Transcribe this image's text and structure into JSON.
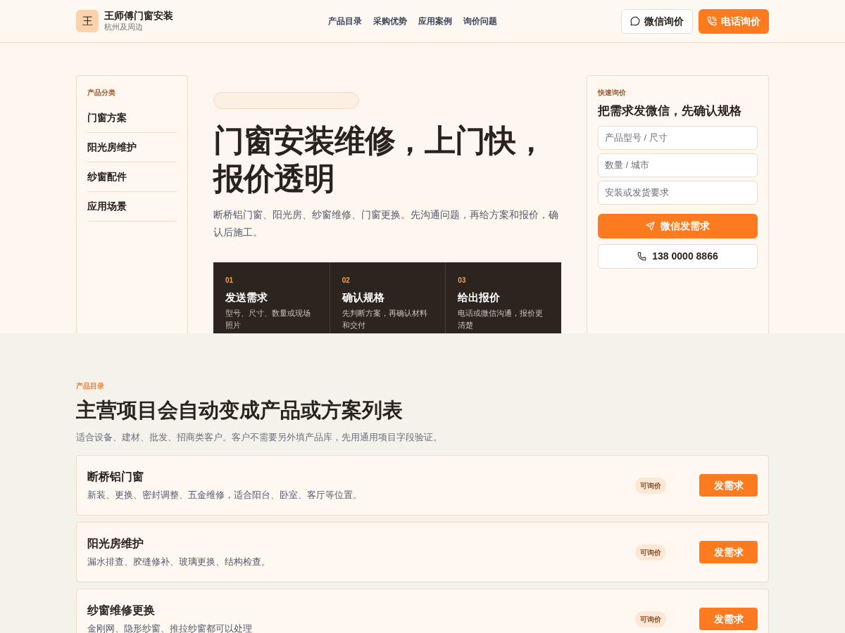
{
  "header": {
    "logo_char": "王",
    "brand": "王师傅门窗安装",
    "region": "杭州及周边",
    "nav": [
      "产品目录",
      "采购优势",
      "应用案例",
      "询价问题"
    ],
    "buttons": [
      {
        "kind": "wechat",
        "label": "微信询价"
      },
      {
        "kind": "phone",
        "label": "电话询价"
      }
    ]
  },
  "sidebar": {
    "heading": "产品分类",
    "items": [
      "门窗方案",
      "阳光房维护",
      "纱窗配件",
      "应用场景"
    ]
  },
  "hero": {
    "title": "门窗安装维修，上门快，报价透明",
    "intro": "断桥铝门窗、阳光房、纱窗维修、门窗更换。先沟通问题，再给方案和报价，确认后施工。",
    "steps": [
      {
        "number": "01",
        "title": "发送需求",
        "text": "型号、尺寸、数量或现场照片"
      },
      {
        "number": "02",
        "title": "确认规格",
        "text": "先判断方案，再确认材料和交付"
      },
      {
        "number": "03",
        "title": "给出报价",
        "text": "电话或微信沟通，报价更清楚"
      }
    ]
  },
  "quote": {
    "eyebrow": "快速询价",
    "title": "把需求发微信，先确认规格",
    "fields": [
      {
        "placeholder": "产品型号 / 尺寸"
      },
      {
        "placeholder": "数量 / 城市"
      },
      {
        "placeholder": "安装或发货要求"
      }
    ],
    "submit": "微信发需求",
    "phone": "138 0000 8866"
  },
  "catalog": {
    "eyebrow": "产品目录",
    "title": "主营项目会自动变成产品或方案列表",
    "subtitle": "适合设备、建材、批发、招商类客户。客户不需要另外填产品库，先用通用项目字段验证。",
    "items": [
      {
        "name": "断桥铝门窗",
        "desc": "新装、更换、密封调整、五金维修，适合阳台、卧室、客厅等位置。",
        "badge": "可询价",
        "action": "发需求"
      },
      {
        "name": "阳光房维护",
        "desc": "漏水排查、胶缝修补、玻璃更换、结构检查。",
        "badge": "可询价",
        "action": "发需求"
      },
      {
        "name": "纱窗维修更换",
        "desc": "金刚网、隐形纱窗、推拉纱窗都可以处理",
        "badge": "可询价",
        "action": "发需求"
      }
    ]
  }
}
